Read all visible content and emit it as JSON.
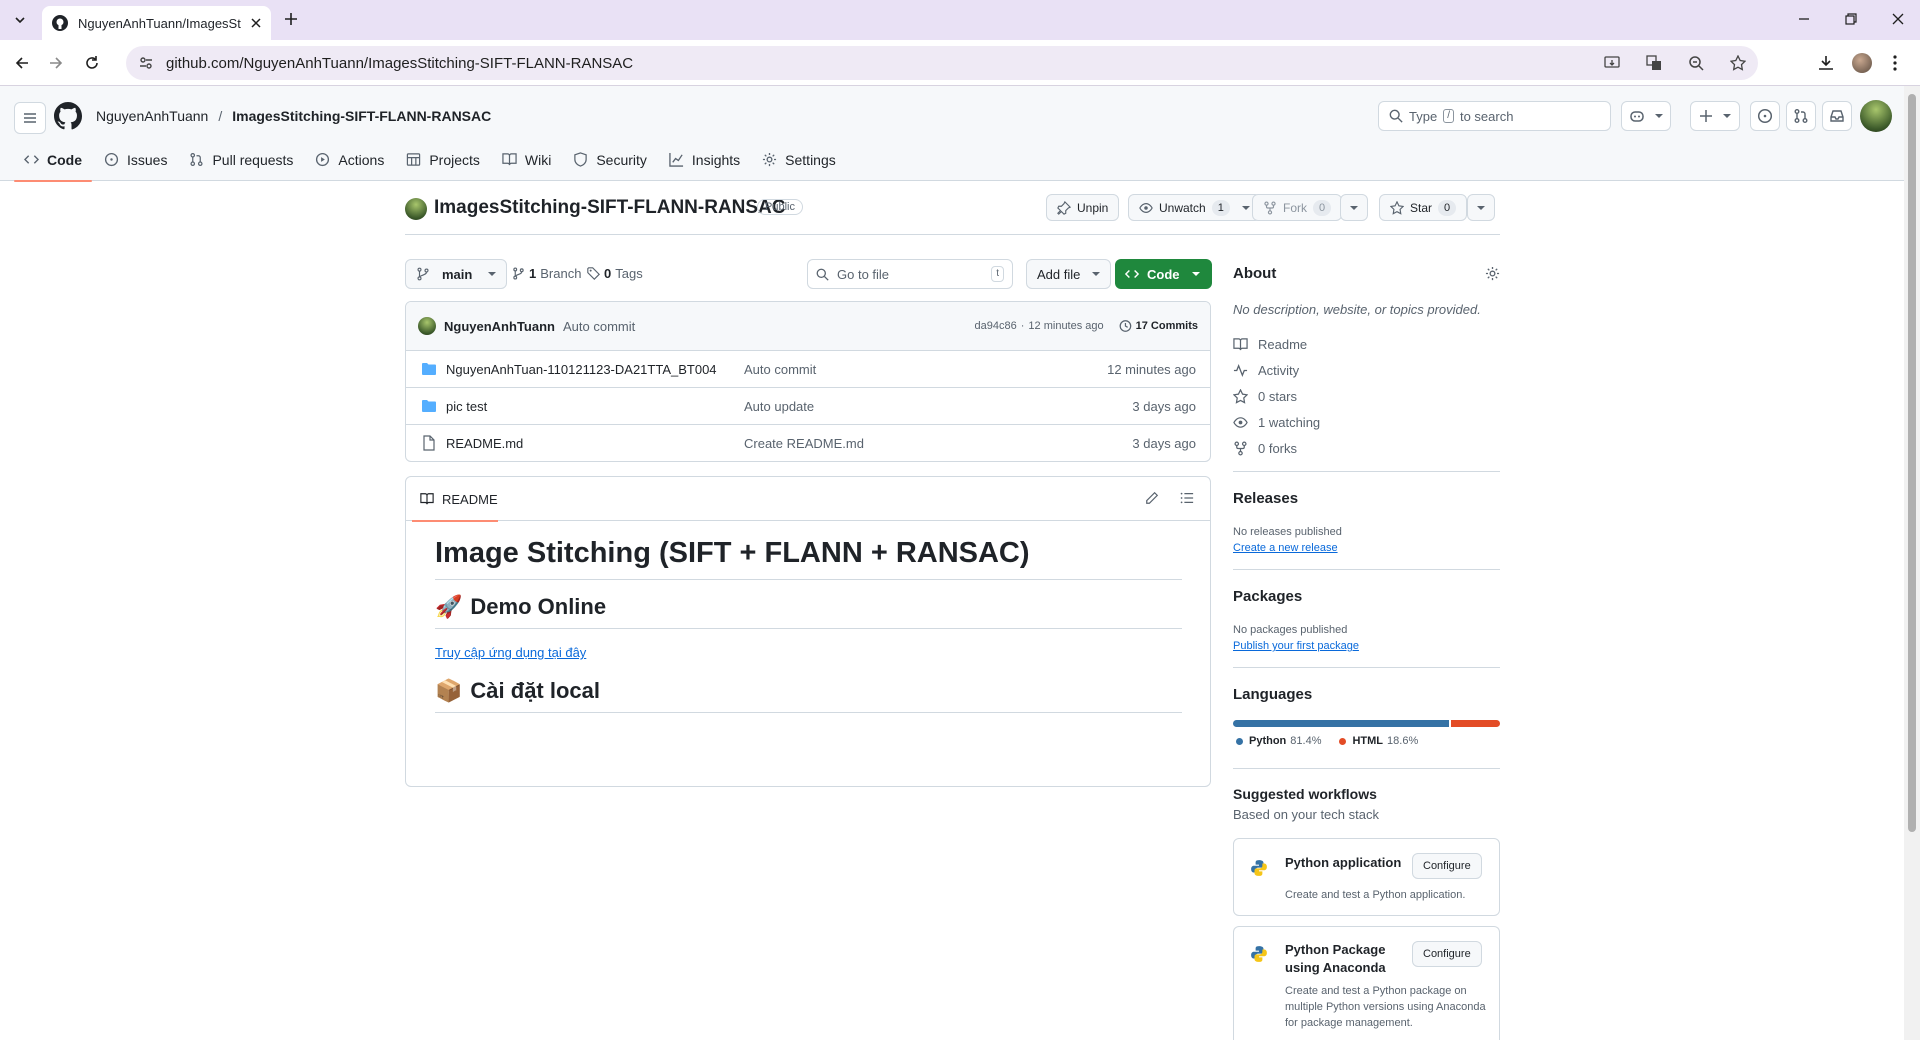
{
  "browser": {
    "tab_title": "NguyenAnhTuann/ImagesStitch",
    "url": "github.com/NguyenAnhTuann/ImagesStitching-SIFT-FLANN-RANSAC"
  },
  "header": {
    "owner": "NguyenAnhTuann",
    "sep": "/",
    "repo": "ImagesStitching-SIFT-FLANN-RANSAC",
    "search_pre": "Type",
    "search_key": "/",
    "search_post": "to search"
  },
  "nav": {
    "tabs": [
      {
        "label": "Code",
        "icon": "code-icon"
      },
      {
        "label": "Issues",
        "icon": "issue-icon"
      },
      {
        "label": "Pull requests",
        "icon": "pull-request-icon"
      },
      {
        "label": "Actions",
        "icon": "play-icon"
      },
      {
        "label": "Projects",
        "icon": "table-icon"
      },
      {
        "label": "Wiki",
        "icon": "book-icon"
      },
      {
        "label": "Security",
        "icon": "shield-icon"
      },
      {
        "label": "Insights",
        "icon": "graph-icon"
      },
      {
        "label": "Settings",
        "icon": "gear-icon"
      }
    ]
  },
  "repo": {
    "name": "ImagesStitching-SIFT-FLANN-RANSAC",
    "visibility": "Public",
    "unpin": "Unpin",
    "unwatch": "Unwatch",
    "watch_count": "1",
    "fork": "Fork",
    "fork_count": "0",
    "star": "Star",
    "star_count": "0"
  },
  "toolbar": {
    "branch": "main",
    "branches_n": "1",
    "branches_label": "Branch",
    "tags_n": "0",
    "tags_label": "Tags",
    "goto_placeholder": "Go to file",
    "goto_key": "t",
    "add_file": "Add file",
    "code": "Code"
  },
  "commit": {
    "author": "NguyenAnhTuann",
    "message": "Auto commit",
    "hash": "da94c86",
    "sep": "·",
    "time": "12 minutes ago",
    "commits": "17 Commits"
  },
  "files": [
    {
      "type": "folder",
      "name": "NguyenAnhTuan-110121123-DA21TTA_BT004",
      "message": "Auto commit",
      "time": "12 minutes ago"
    },
    {
      "type": "folder",
      "name": "pic test",
      "message": "Auto update",
      "time": "3 days ago"
    },
    {
      "type": "file",
      "name": "README.md",
      "message": "Create README.md",
      "time": "3 days ago"
    }
  ],
  "readme": {
    "tab": "README",
    "h1": "Image Stitching (SIFT + FLANN + RANSAC)",
    "h2a_emoji": "🚀",
    "h2a": "Demo Online",
    "link": "Truy cập ứng dụng tại đây",
    "h2b_emoji": "📦",
    "h2b": "Cài đặt local"
  },
  "about": {
    "title": "About",
    "desc": "No description, website, or topics provided.",
    "items": [
      {
        "icon": "book-icon",
        "label": "Readme"
      },
      {
        "icon": "pulse-icon",
        "label": "Activity"
      },
      {
        "icon": "star-icon",
        "label": "0 stars"
      },
      {
        "icon": "eye-icon",
        "label": "1 watching"
      },
      {
        "icon": "fork-icon",
        "label": "0 forks"
      }
    ]
  },
  "releases": {
    "title": "Releases",
    "none": "No releases published",
    "link": "Create a new release"
  },
  "packages": {
    "title": "Packages",
    "none": "No packages published",
    "link": "Publish your first package"
  },
  "languages": {
    "title": "Languages",
    "items": [
      {
        "name": "Python",
        "pct": "81.4%",
        "value": 81.4,
        "color": "#3572a5"
      },
      {
        "name": "HTML",
        "pct": "18.6%",
        "value": 18.6,
        "color": "#e34c26"
      }
    ]
  },
  "workflows": {
    "title": "Suggested workflows",
    "subtitle": "Based on your tech stack",
    "items": [
      {
        "name": "Python application",
        "desc": "Create and test a Python application.",
        "btn": "Configure"
      },
      {
        "name": "Python Package using Anaconda",
        "desc": "Create and test a Python package on multiple Python versions using Anaconda for package management.",
        "btn": "Configure"
      }
    ]
  }
}
